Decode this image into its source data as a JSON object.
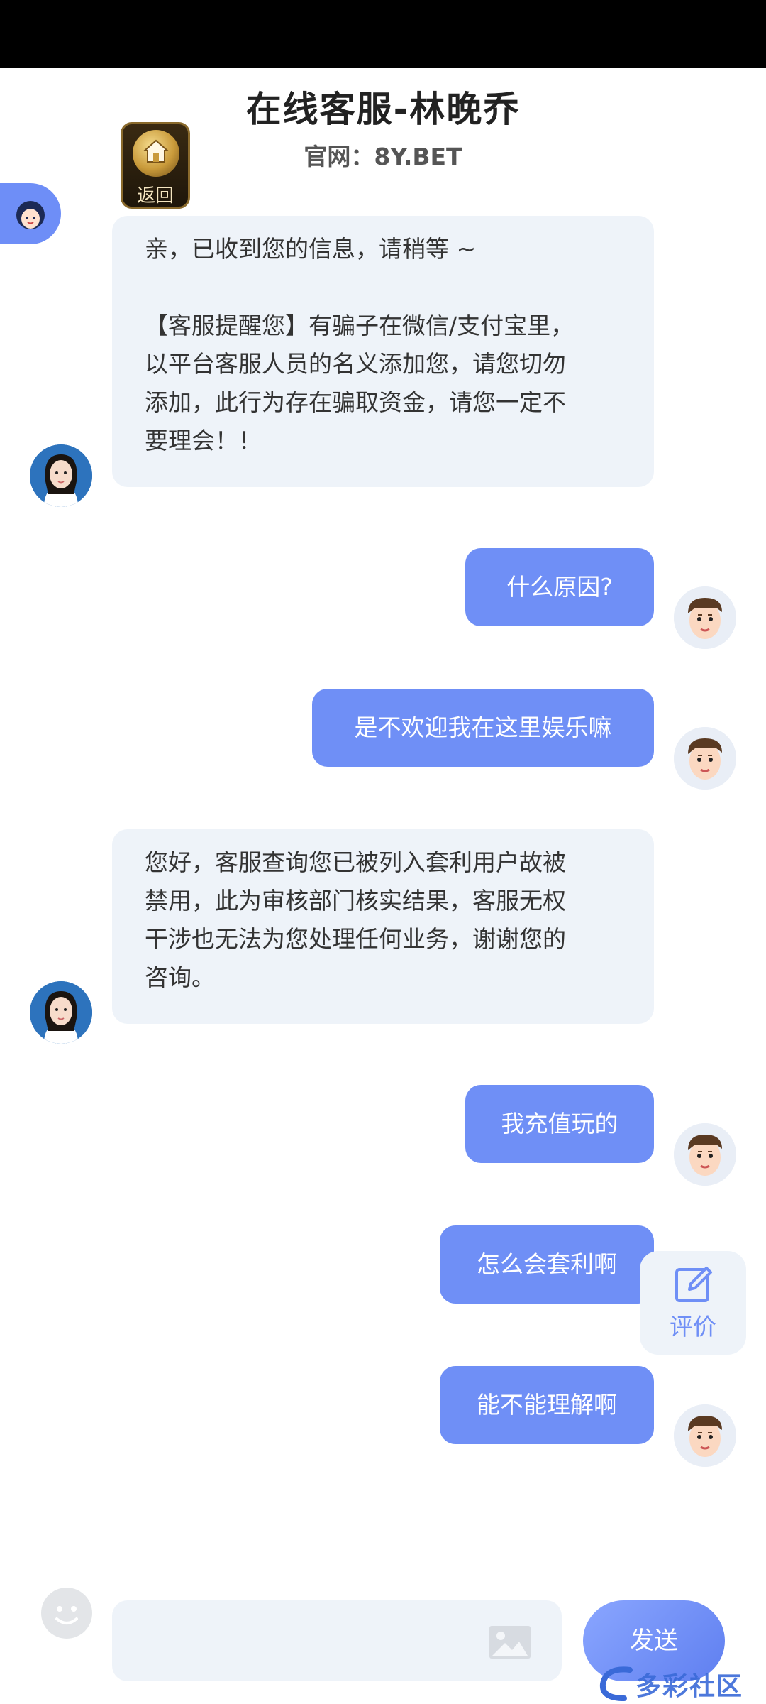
{
  "header": {
    "title": "在线客服-林晚乔",
    "subtitle": "官网：8Y.BET"
  },
  "home_button": {
    "label": "返回"
  },
  "messages": [
    {
      "from": "agent",
      "text": "亲，已收到您的信息，请稍等 ~\n\n【客服提醒您】有骗子在微信/支付宝里，\n以平台客服人员的名义添加您，请您切勿\n添加，此行为存在骗取资金，请您一定不\n要理会！！"
    },
    {
      "from": "user",
      "text": "什么原因?"
    },
    {
      "from": "user",
      "text": "是不欢迎我在这里娱乐嘛"
    },
    {
      "from": "agent",
      "text": "您好，客服查询您已被列入套利用户故被\n禁用，此为审核部门核实结果，客服无权\n干涉也无法为您处理任何业务，谢谢您的\n咨询。"
    },
    {
      "from": "user",
      "text": "我充值玩的"
    },
    {
      "from": "user",
      "text": "怎么会套利啊"
    },
    {
      "from": "user",
      "text": "能不能理解啊"
    }
  ],
  "rate_button": {
    "label": "评价"
  },
  "composer": {
    "input_value": "",
    "send_label": "发送"
  },
  "watermark": {
    "text": "多彩社区"
  },
  "colors": {
    "accent": "#6f8ff6",
    "agent_bubble": "#eef3f9",
    "status_bar": "#000000"
  }
}
